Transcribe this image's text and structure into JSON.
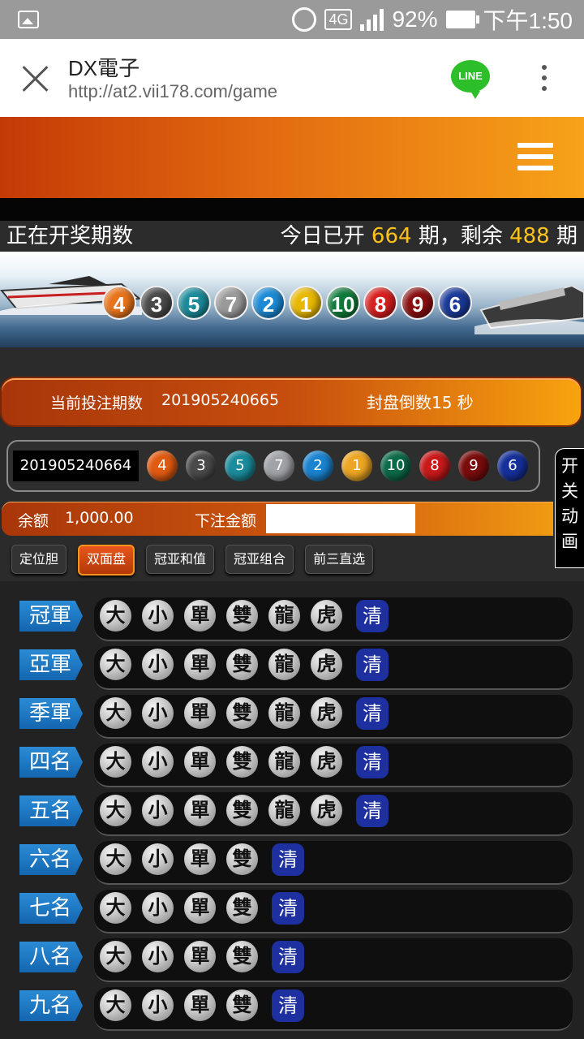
{
  "statusbar": {
    "battery": "92%",
    "time": "下午1:50",
    "network": "4G"
  },
  "browser": {
    "title": "DX電子",
    "url": "http://at2.vii178.com/game",
    "line_label": "LINE"
  },
  "draw_info": {
    "left": "正在开奖期数",
    "prefix": "今日已开 ",
    "opened": "664",
    "mid": " 期，剩余 ",
    "remaining": "488",
    "suffix": " 期"
  },
  "banner_balls": [
    {
      "n": "4",
      "color": "#e8731a"
    },
    {
      "n": "3",
      "color": "#4a4a4a"
    },
    {
      "n": "5",
      "color": "#1b8a9a"
    },
    {
      "n": "7",
      "color": "#9a9a9a"
    },
    {
      "n": "2",
      "color": "#1a8ad6"
    },
    {
      "n": "1",
      "color": "#e8b800"
    },
    {
      "n": "10",
      "color": "#0e7a3a"
    },
    {
      "n": "8",
      "color": "#d81e1e"
    },
    {
      "n": "9",
      "color": "#8a1010"
    },
    {
      "n": "6",
      "color": "#1a3a9a"
    }
  ],
  "current": {
    "label": "当前投注期数",
    "period": "201905240665",
    "countdown": "封盘倒数15 秒"
  },
  "last_result": {
    "period": "201905240664",
    "balls": [
      {
        "n": "4",
        "color": "#e05a12"
      },
      {
        "n": "3",
        "color": "#4a4a4a"
      },
      {
        "n": "5",
        "color": "#1a8c9c"
      },
      {
        "n": "7",
        "color": "#a0a4a8"
      },
      {
        "n": "2",
        "color": "#1a84d0"
      },
      {
        "n": "1",
        "color": "#eda623"
      },
      {
        "n": "10",
        "color": "#0c6a48"
      },
      {
        "n": "8",
        "color": "#c81a1a"
      },
      {
        "n": "9",
        "color": "#7a0c0c"
      },
      {
        "n": "6",
        "color": "#16309a"
      }
    ]
  },
  "anim_toggle": [
    "开",
    "关",
    "动",
    "画"
  ],
  "balance": {
    "label": "余额",
    "value": "1,000.00",
    "bet_label": "下注金额",
    "bet_value": ""
  },
  "tabs": [
    {
      "label": "定位胆",
      "active": false
    },
    {
      "label": "双面盘",
      "active": true
    },
    {
      "label": "冠亚和值",
      "active": false
    },
    {
      "label": "冠亚组合",
      "active": false
    },
    {
      "label": "前三直选",
      "active": false
    }
  ],
  "rows": [
    {
      "label": "冠軍",
      "chips": [
        "大",
        "小",
        "單",
        "雙",
        "龍",
        "虎"
      ]
    },
    {
      "label": "亞軍",
      "chips": [
        "大",
        "小",
        "單",
        "雙",
        "龍",
        "虎"
      ]
    },
    {
      "label": "季軍",
      "chips": [
        "大",
        "小",
        "單",
        "雙",
        "龍",
        "虎"
      ]
    },
    {
      "label": "四名",
      "chips": [
        "大",
        "小",
        "單",
        "雙",
        "龍",
        "虎"
      ]
    },
    {
      "label": "五名",
      "chips": [
        "大",
        "小",
        "單",
        "雙",
        "龍",
        "虎"
      ]
    },
    {
      "label": "六名",
      "chips": [
        "大",
        "小",
        "單",
        "雙"
      ]
    },
    {
      "label": "七名",
      "chips": [
        "大",
        "小",
        "單",
        "雙"
      ]
    },
    {
      "label": "八名",
      "chips": [
        "大",
        "小",
        "單",
        "雙"
      ]
    },
    {
      "label": "九名",
      "chips": [
        "大",
        "小",
        "單",
        "雙"
      ]
    }
  ],
  "clear_label": "清"
}
